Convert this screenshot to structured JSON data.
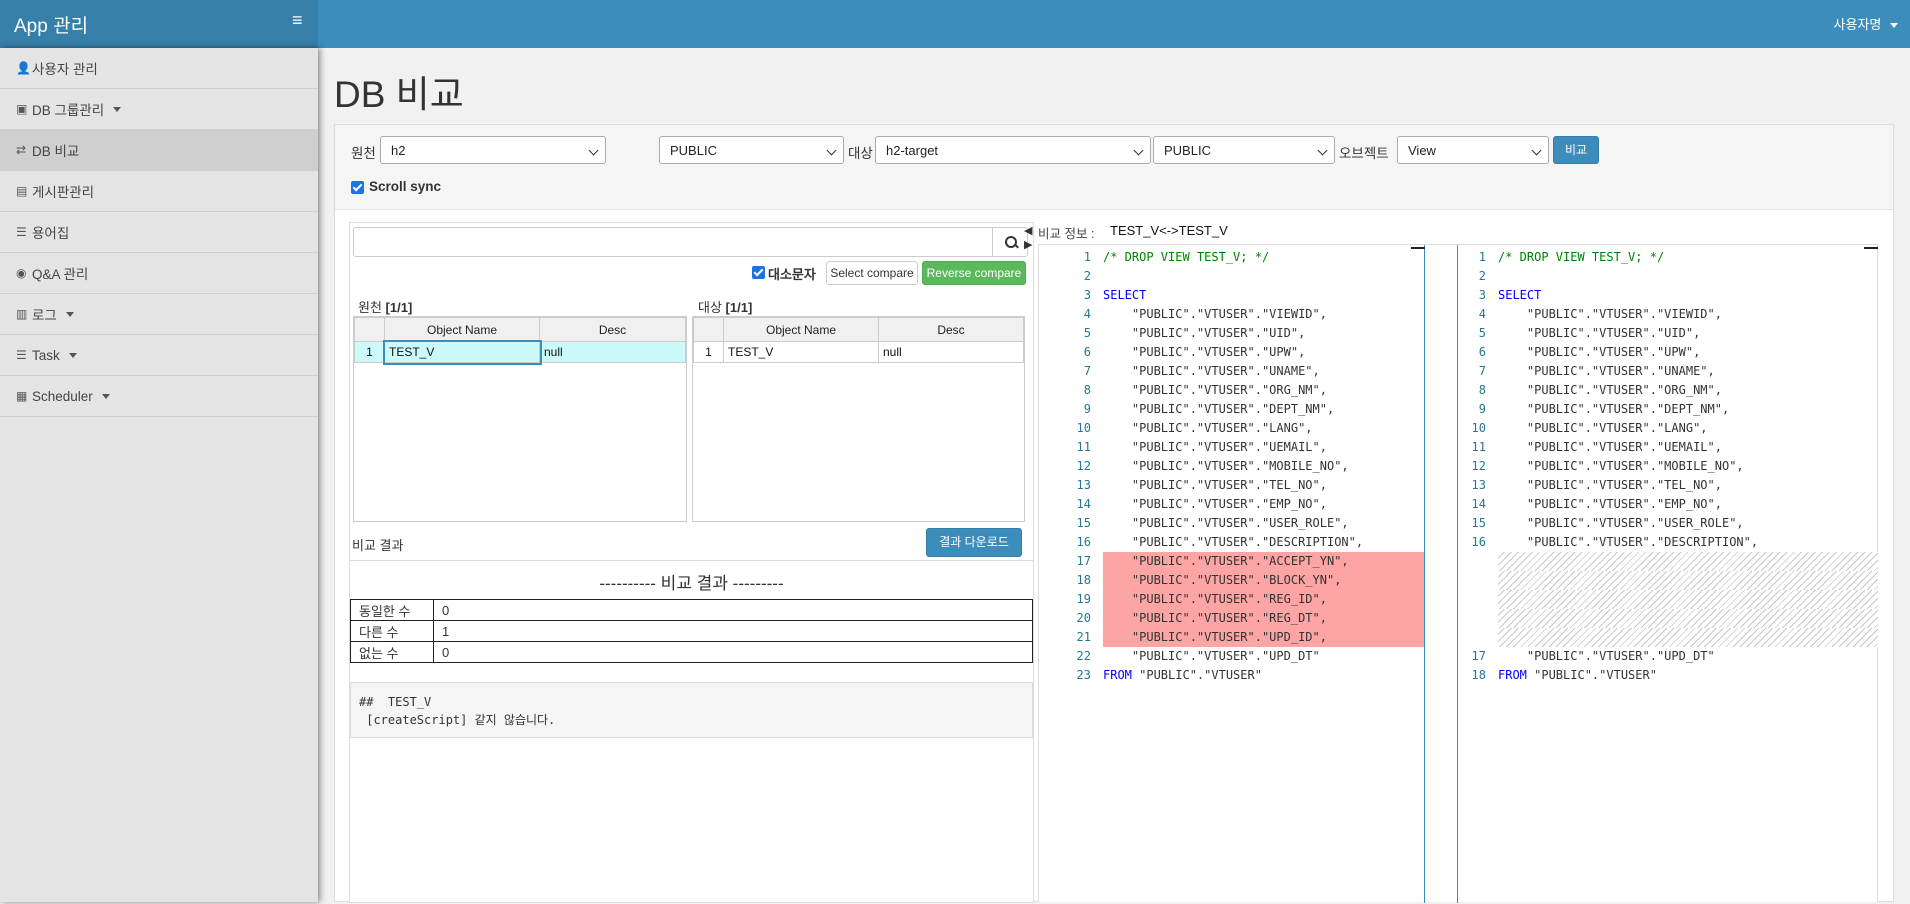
{
  "app": {
    "title": "App 관리",
    "user_menu": "사용자명"
  },
  "sidebar": {
    "items": [
      {
        "label": "사용자 관리",
        "icon": "user-icon",
        "glyph": "👤",
        "caret": false
      },
      {
        "label": "DB 그룹관리",
        "icon": "db-group-icon",
        "glyph": "▣",
        "caret": true
      },
      {
        "label": "DB 비교",
        "icon": "exchange-icon",
        "glyph": "⇄",
        "caret": false,
        "active": true
      },
      {
        "label": "게시판관리",
        "icon": "board-icon",
        "glyph": "▤",
        "caret": false
      },
      {
        "label": "용어집",
        "icon": "list-icon",
        "glyph": "☰",
        "caret": false
      },
      {
        "label": "Q&A 관리",
        "icon": "eye-icon",
        "glyph": "◉",
        "caret": false
      },
      {
        "label": "로그",
        "icon": "chart-icon",
        "glyph": "▥",
        "caret": true
      },
      {
        "label": "Task",
        "icon": "tasks-icon",
        "glyph": "☰",
        "caret": true
      },
      {
        "label": "Scheduler",
        "icon": "calendar-icon",
        "glyph": "▦",
        "caret": true
      }
    ]
  },
  "page": {
    "title": "DB 비교"
  },
  "toolbar": {
    "source_label": "원천",
    "source_db": "h2",
    "source_schema": "PUBLIC",
    "target_label": "대상",
    "target_db": "h2-target",
    "target_schema": "PUBLIC",
    "object_label": "오브젝트",
    "object_type": "View",
    "compare_button": "비교",
    "scroll_sync_label": "Scroll sync"
  },
  "left": {
    "case_label": "대소문자",
    "select_compare": "Select compare",
    "reverse_compare": "Reverse compare",
    "source_title": "원천",
    "source_count": "[1/1]",
    "target_title": "대상",
    "target_count": "[1/1]",
    "col_name": "Object Name",
    "col_desc": "Desc",
    "source_rows": [
      {
        "no": "1",
        "name": "TEST_V",
        "desc": "null"
      }
    ],
    "target_rows": [
      {
        "no": "1",
        "name": "TEST_V",
        "desc": "null"
      }
    ],
    "result_label": "비교 결과",
    "download_button": "결과 다운로드",
    "result_heading": "---------- 비교 결과 ---------",
    "stats": [
      {
        "label": "동일한 수",
        "value": "0"
      },
      {
        "label": "다른 수",
        "value": "1"
      },
      {
        "label": "없는 수",
        "value": "0"
      }
    ],
    "result_text": "##  TEST_V\n [createScript] 같지 않습니다."
  },
  "compare": {
    "info_label": "비교 정보 :",
    "info_value": "TEST_V<->TEST_V",
    "left_lines": [
      {
        "n": "1",
        "t": "/* DROP VIEW TEST_V; */",
        "c": "cm"
      },
      {
        "n": "2",
        "t": ""
      },
      {
        "n": "3",
        "t": "SELECT",
        "c": "kw"
      },
      {
        "n": "4",
        "t": "    \"PUBLIC\".\"VTUSER\".\"VIEWID\","
      },
      {
        "n": "5",
        "t": "    \"PUBLIC\".\"VTUSER\".\"UID\","
      },
      {
        "n": "6",
        "t": "    \"PUBLIC\".\"VTUSER\".\"UPW\","
      },
      {
        "n": "7",
        "t": "    \"PUBLIC\".\"VTUSER\".\"UNAME\","
      },
      {
        "n": "8",
        "t": "    \"PUBLIC\".\"VTUSER\".\"ORG_NM\","
      },
      {
        "n": "9",
        "t": "    \"PUBLIC\".\"VTUSER\".\"DEPT_NM\","
      },
      {
        "n": "10",
        "t": "    \"PUBLIC\".\"VTUSER\".\"LANG\","
      },
      {
        "n": "11",
        "t": "    \"PUBLIC\".\"VTUSER\".\"UEMAIL\","
      },
      {
        "n": "12",
        "t": "    \"PUBLIC\".\"VTUSER\".\"MOBILE_NO\","
      },
      {
        "n": "13",
        "t": "    \"PUBLIC\".\"VTUSER\".\"TEL_NO\","
      },
      {
        "n": "14",
        "t": "    \"PUBLIC\".\"VTUSER\".\"EMP_NO\","
      },
      {
        "n": "15",
        "t": "    \"PUBLIC\".\"VTUSER\".\"USER_ROLE\","
      },
      {
        "n": "16",
        "t": "    \"PUBLIC\".\"VTUSER\".\"DESCRIPTION\","
      },
      {
        "n": "17",
        "t": "    \"PUBLIC\".\"VTUSER\".\"ACCEPT_YN\",",
        "c": "del"
      },
      {
        "n": "18",
        "t": "    \"PUBLIC\".\"VTUSER\".\"BLOCK_YN\",",
        "c": "del"
      },
      {
        "n": "19",
        "t": "    \"PUBLIC\".\"VTUSER\".\"REG_ID\",",
        "c": "del"
      },
      {
        "n": "20",
        "t": "    \"PUBLIC\".\"VTUSER\".\"REG_DT\",",
        "c": "del"
      },
      {
        "n": "21",
        "t": "    \"PUBLIC\".\"VTUSER\".\"UPD_ID\",",
        "c": "del"
      },
      {
        "n": "22",
        "t": "    \"PUBLIC\".\"VTUSER\".\"UPD_DT\""
      },
      {
        "n": "23",
        "t": "FROM \"PUBLIC\".\"VTUSER\"",
        "c": "from"
      }
    ],
    "right_lines": [
      {
        "n": "1",
        "t": "/* DROP VIEW TEST_V; */",
        "c": "cm"
      },
      {
        "n": "2",
        "t": ""
      },
      {
        "n": "3",
        "t": "SELECT",
        "c": "kw"
      },
      {
        "n": "4",
        "t": "    \"PUBLIC\".\"VTUSER\".\"VIEWID\","
      },
      {
        "n": "5",
        "t": "    \"PUBLIC\".\"VTUSER\".\"UID\","
      },
      {
        "n": "6",
        "t": "    \"PUBLIC\".\"VTUSER\".\"UPW\","
      },
      {
        "n": "7",
        "t": "    \"PUBLIC\".\"VTUSER\".\"UNAME\","
      },
      {
        "n": "8",
        "t": "    \"PUBLIC\".\"VTUSER\".\"ORG_NM\","
      },
      {
        "n": "9",
        "t": "    \"PUBLIC\".\"VTUSER\".\"DEPT_NM\","
      },
      {
        "n": "10",
        "t": "    \"PUBLIC\".\"VTUSER\".\"LANG\","
      },
      {
        "n": "11",
        "t": "    \"PUBLIC\".\"VTUSER\".\"UEMAIL\","
      },
      {
        "n": "12",
        "t": "    \"PUBLIC\".\"VTUSER\".\"MOBILE_NO\","
      },
      {
        "n": "13",
        "t": "    \"PUBLIC\".\"VTUSER\".\"TEL_NO\","
      },
      {
        "n": "14",
        "t": "    \"PUBLIC\".\"VTUSER\".\"EMP_NO\","
      },
      {
        "n": "15",
        "t": "    \"PUBLIC\".\"VTUSER\".\"USER_ROLE\","
      },
      {
        "n": "16",
        "t": "    \"PUBLIC\".\"VTUSER\".\"DESCRIPTION\","
      },
      {
        "n": "",
        "t": "",
        "c": "hatch"
      },
      {
        "n": "",
        "t": "",
        "c": "hatch"
      },
      {
        "n": "",
        "t": "",
        "c": "hatch"
      },
      {
        "n": "",
        "t": "",
        "c": "hatch"
      },
      {
        "n": "",
        "t": "",
        "c": "hatch"
      },
      {
        "n": "17",
        "t": "    \"PUBLIC\".\"VTUSER\".\"UPD_DT\""
      },
      {
        "n": "18",
        "t": "FROM \"PUBLIC\".\"VTUSER\"",
        "c": "from"
      }
    ]
  }
}
